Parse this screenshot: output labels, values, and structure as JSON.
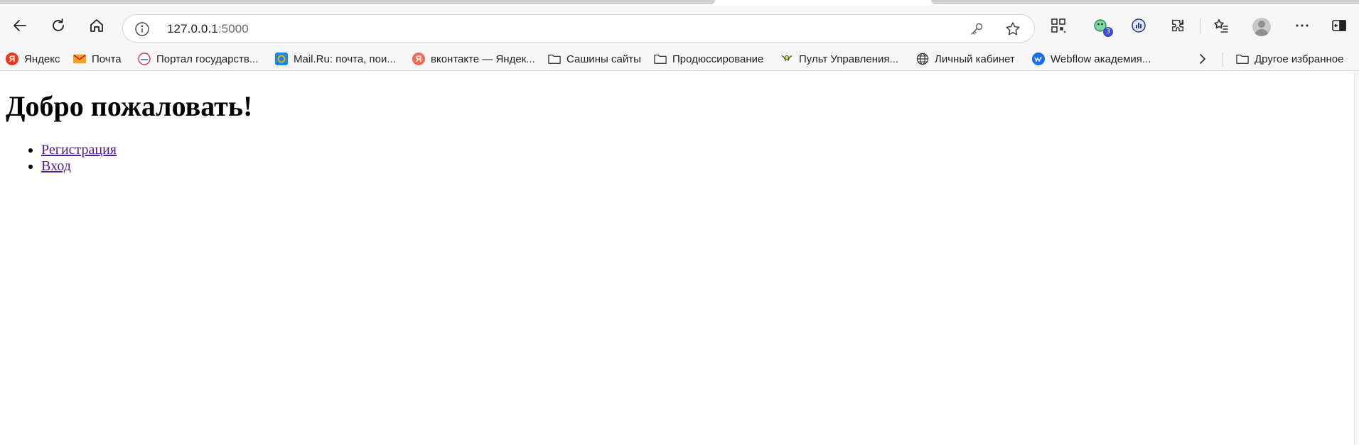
{
  "browser": {
    "address_bar": {
      "host": "127.0.0.1",
      "port": ":5000"
    },
    "badge_count": "3",
    "bookmarks": [
      {
        "label": "Яндекс",
        "icon": "yandex-icon"
      },
      {
        "label": "Почта",
        "icon": "mail-envelope-icon"
      },
      {
        "label": "Портал государств...",
        "icon": "gosuslugi-icon"
      },
      {
        "label": "Mail.Ru: почта, пои...",
        "icon": "mailru-icon"
      },
      {
        "label": "вконтакте — Яндек...",
        "icon": "yandex-icon"
      },
      {
        "label": "Сашины сайты",
        "icon": "folder-icon"
      },
      {
        "label": "Продюссирование",
        "icon": "folder-icon"
      },
      {
        "label": "Пульт Управления...",
        "icon": "control-panel-icon"
      },
      {
        "label": "Личный кабинет",
        "icon": "globe-icon"
      },
      {
        "label": "Webflow академия...",
        "icon": "webflow-icon"
      }
    ],
    "other_bookmarks": "Другое избранное"
  },
  "page": {
    "heading": "Добро пожаловать!",
    "links": [
      {
        "label": "Регистрация"
      },
      {
        "label": "Вход"
      }
    ]
  },
  "colors": {
    "link": "#551a8b",
    "yandex": "#f0361e"
  }
}
